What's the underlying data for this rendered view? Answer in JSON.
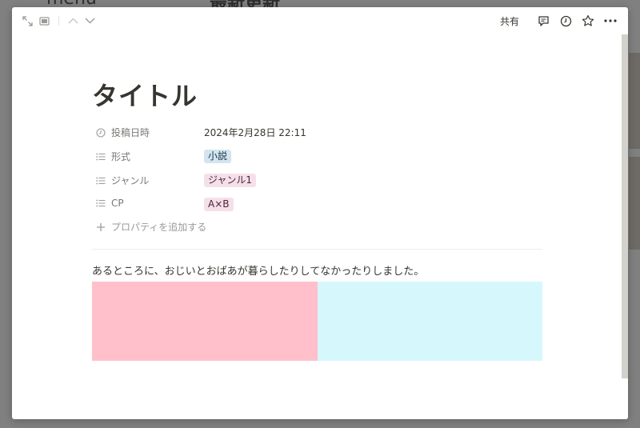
{
  "background": {
    "menu_text": "menu",
    "latest_text": "最新更新"
  },
  "toolbar": {
    "expand_icon": "expand-icon",
    "peek_icon": "side-peek-icon",
    "up_icon": "chevron-up-icon",
    "down_icon": "chevron-down-icon",
    "share_label": "共有",
    "comment_icon": "comment-icon",
    "history_icon": "clock-icon",
    "favorite_icon": "star-icon",
    "more_icon": "more-icon"
  },
  "page": {
    "title": "タイトル",
    "properties": [
      {
        "name": "投稿日時",
        "icon": "clock-icon",
        "value": "2024年2月28日 22:11",
        "type": "date"
      },
      {
        "name": "形式",
        "icon": "list-icon",
        "value": "小説",
        "type": "tag"
      },
      {
        "name": "ジャンル",
        "icon": "list-icon",
        "value": "ジャンル1",
        "type": "tag"
      },
      {
        "name": "CP",
        "icon": "list-icon",
        "value": "A×B",
        "type": "tag"
      }
    ],
    "add_property_label": "プロパティを追加する",
    "body_text": "あるところに、おじいとおばあが暮らしたりしてなかったりしました。",
    "blocks": {
      "left_color": "#ffc0cb",
      "right_color": "#d6f8fd"
    }
  },
  "colors": {
    "overlay": "#808080",
    "modal_bg": "#ffffff",
    "text": "#37352f",
    "muted": "#787774"
  }
}
